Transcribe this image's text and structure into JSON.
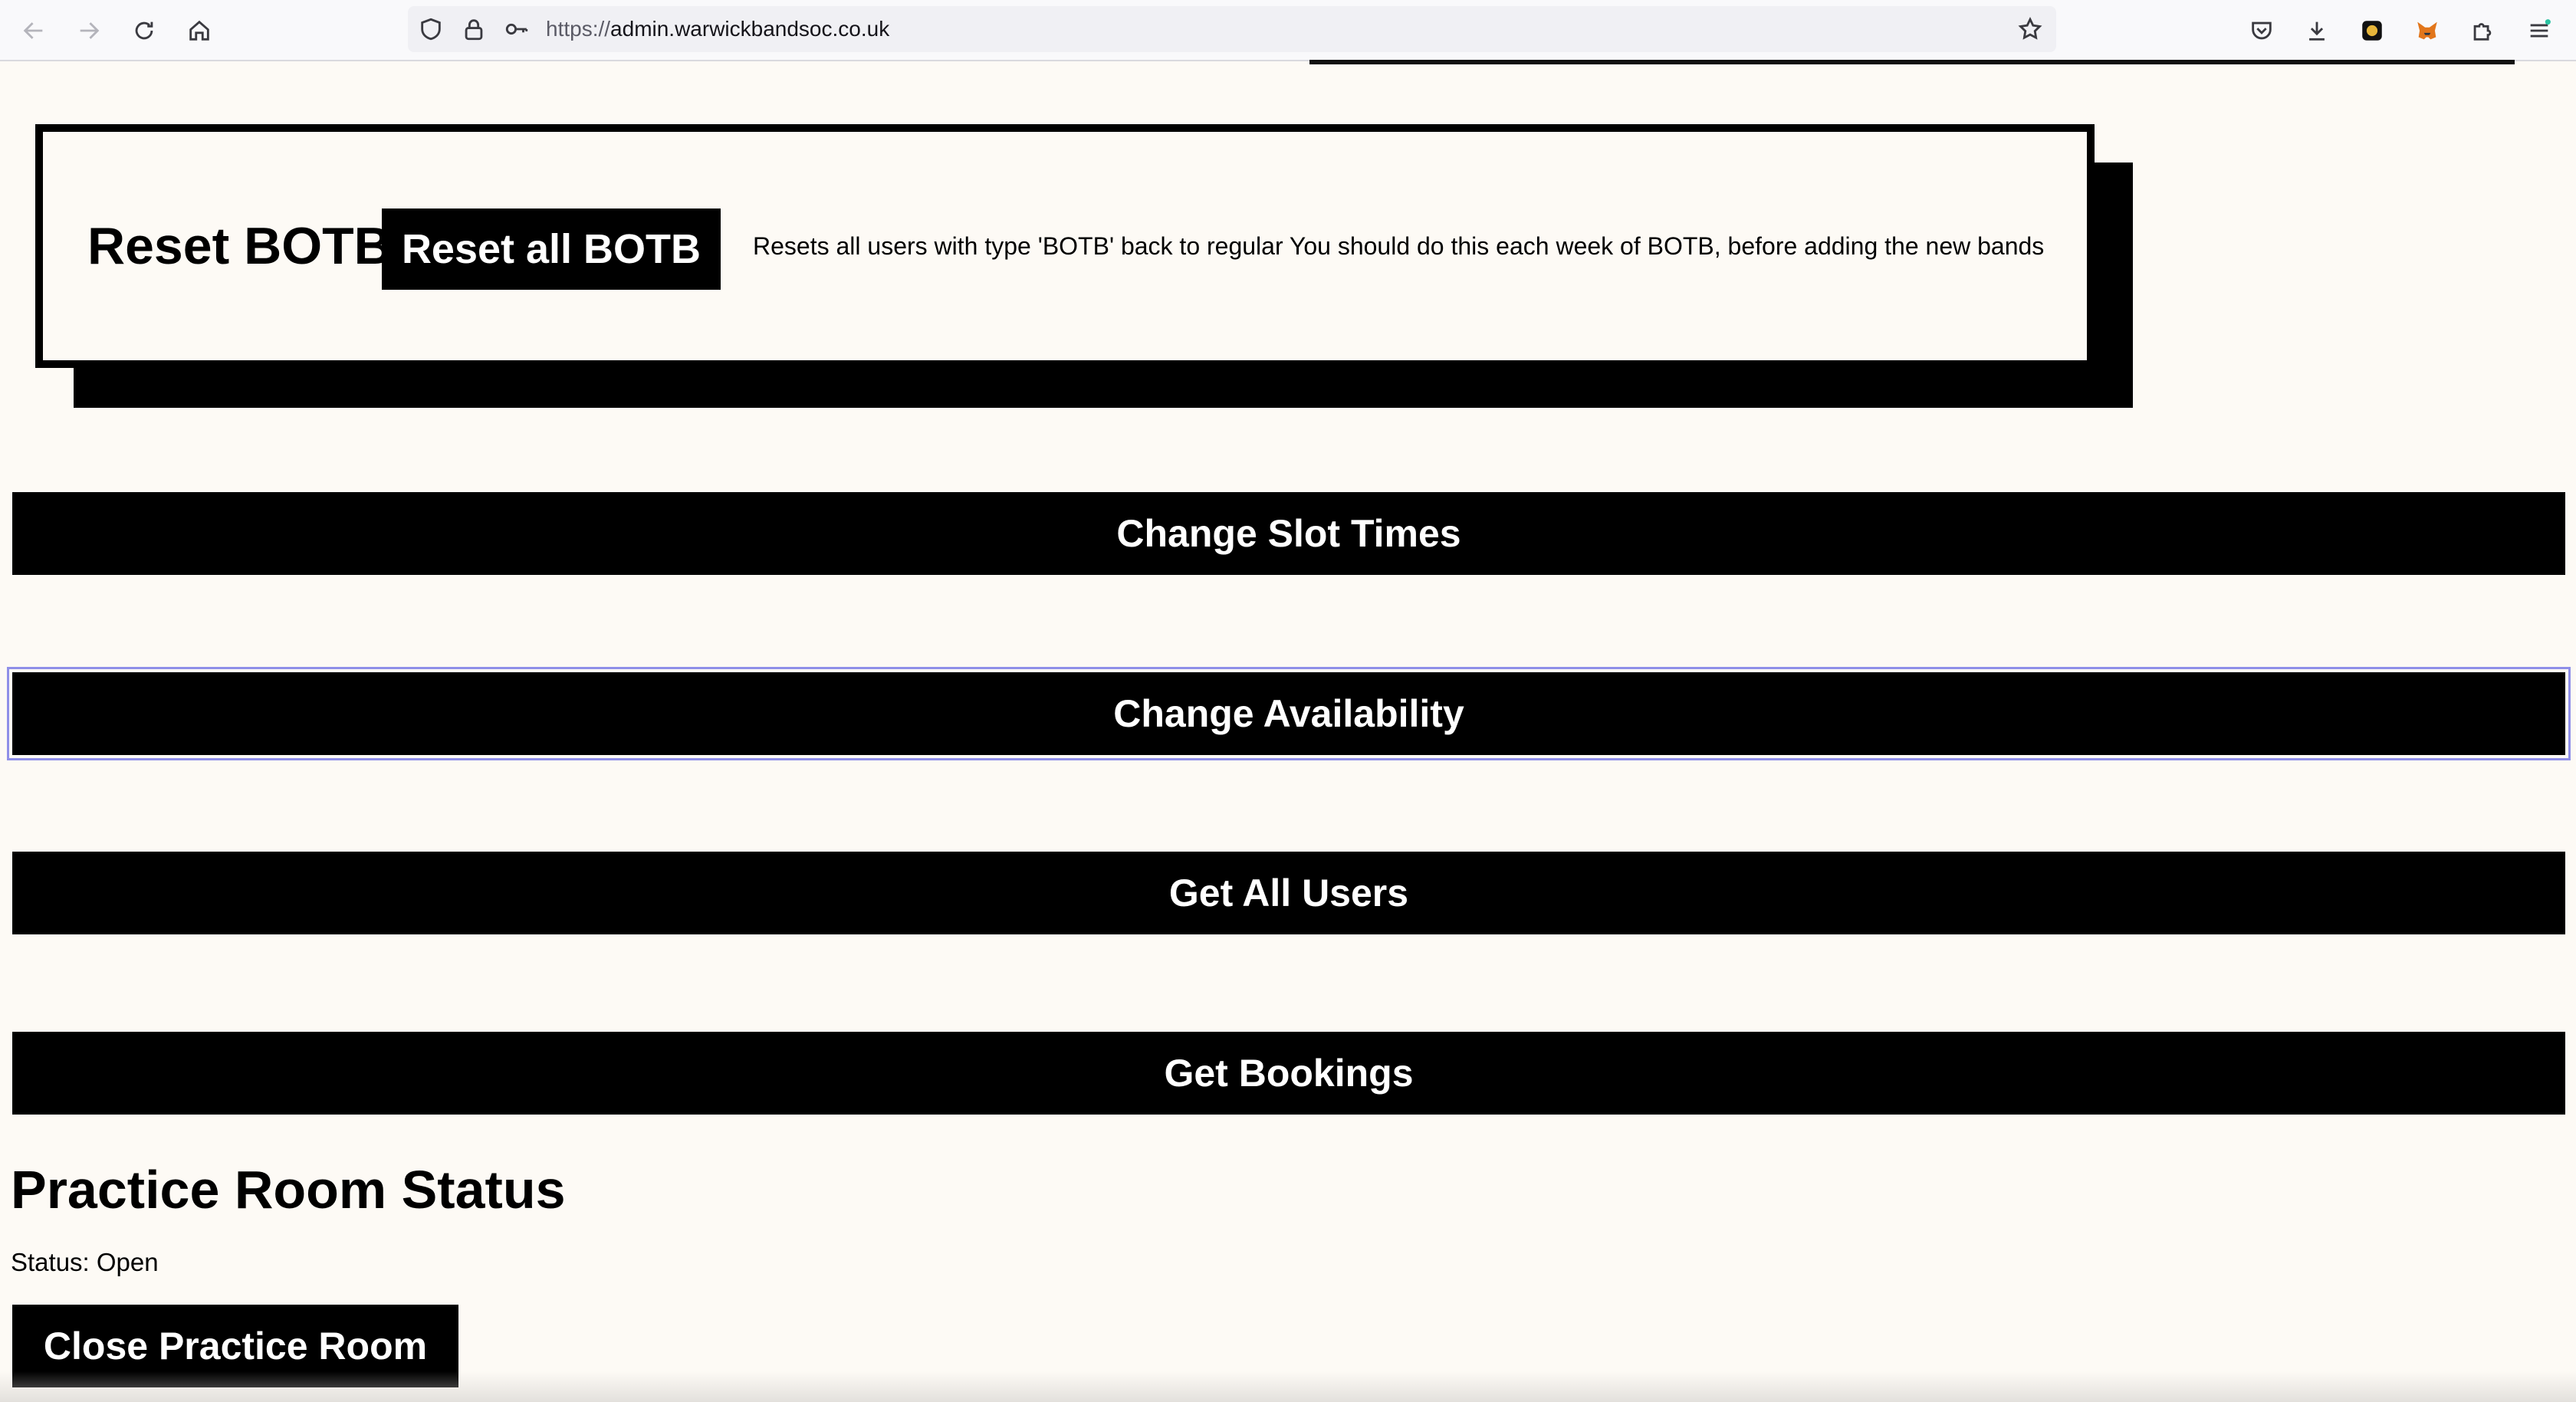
{
  "browser": {
    "url_protocol": "https://",
    "url_host": "admin.warwickbandsoc.co.uk",
    "nav_icons": [
      "back-icon",
      "forward-icon",
      "reload-icon",
      "home-icon"
    ],
    "url_icons": [
      "shield-icon",
      "lock-icon",
      "key-icon"
    ],
    "right_icons": [
      "pocket-icon",
      "download-icon",
      "extension-icon",
      "metamask-fox-icon",
      "extensions-puzzle-icon",
      "menu-icon"
    ]
  },
  "botb": {
    "title": "Reset BOTB",
    "button_label": "Reset all BOTB",
    "description": "Resets all users with type 'BOTB' back to regular You should do this each week of BOTB, before adding the new bands"
  },
  "actions": {
    "change_slot_times": "Change Slot Times",
    "change_availability": "Change Availability",
    "get_all_users": "Get All Users",
    "get_bookings": "Get Bookings"
  },
  "practice_room": {
    "heading": "Practice Room Status",
    "status_text": "Status: Open",
    "close_button": "Close Practice Room"
  },
  "colors": {
    "page_background": "#fdfaf5",
    "button_background": "#000000",
    "button_text": "#ffffff",
    "focus_ring": "#8f8fe8"
  }
}
